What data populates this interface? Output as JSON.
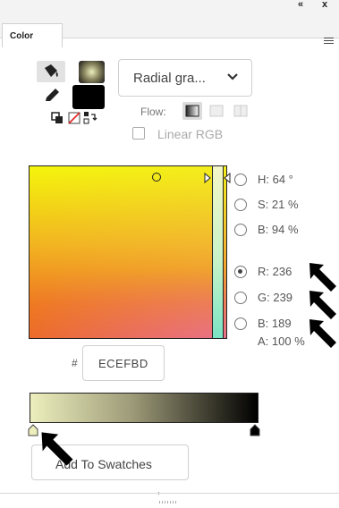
{
  "panel": {
    "collapse_label": "«",
    "close_label": "x",
    "tab_label": "Color"
  },
  "fill_type": {
    "selected": "Radial gra..."
  },
  "flow": {
    "label": "Flow:"
  },
  "linear_rgb": {
    "label": "Linear RGB",
    "checked": false
  },
  "values": {
    "h": "H: 64 °",
    "s": "S: 21 %",
    "b_hsb": "B: 94 %",
    "r": "R: 236",
    "g": "G: 239",
    "b_rgb": "B: 189",
    "alpha": "A: 100 %",
    "selected_mode": "R"
  },
  "hex": {
    "symbol": "#",
    "value": "ECEFBD"
  },
  "gradient": {
    "stops": [
      "#ecefbd",
      "#000000"
    ]
  },
  "buttons": {
    "add_to_swatches": "Add To Swatches"
  },
  "colors": {
    "current_color": "#ecefbd",
    "stroke_color": "#000000"
  }
}
